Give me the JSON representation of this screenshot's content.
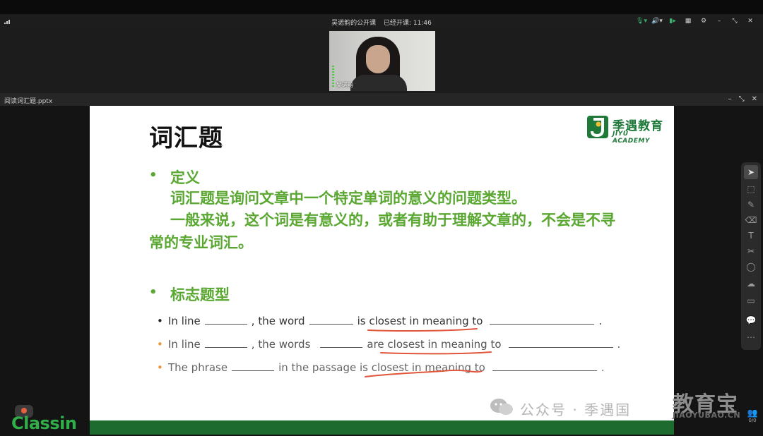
{
  "session": {
    "course_title": "吴诺韵的公开课",
    "elapsed_label": "已经开课: 11:46"
  },
  "video": {
    "participant_name": "吴诺韵"
  },
  "file": {
    "name": "阅读词汇题.pptx"
  },
  "slide": {
    "title": "词汇题",
    "logo_cn": "季遇教育",
    "logo_en": "JIYU ACADEMY",
    "definition_heading": "定义",
    "definition_line1": "词汇题是询问文章中一个特定单词的意义的问题类型。",
    "definition_line2": "一般来说，这个词是有意义的，或者有助于理解文章的，不会是不寻常的专业词汇。",
    "signal_heading": "标志题型",
    "patterns": [
      {
        "a": "In line",
        "b": ", the word",
        "c": "is closest in meaning to",
        "end": "."
      },
      {
        "a": "In line",
        "b": ", the words",
        "c": "are closest in meaning to",
        "end": "."
      },
      {
        "a": "The phrase",
        "b": "in the passage is closest in meaning to",
        "c": "",
        "end": "."
      }
    ]
  },
  "brand": {
    "name": "Classin"
  },
  "watermark": {
    "text": "公众号 · 季遇国",
    "big": "教育宝",
    "url": "JIAOYUBAO.CN"
  },
  "counter": "0/0",
  "colors": {
    "accent_green": "#5aa832",
    "footer_green": "#1e6b2f",
    "ink_red": "#e2553a"
  },
  "toolbar_icons": [
    "cursor-icon",
    "select-icon",
    "pen-icon",
    "eraser-icon",
    "text-icon",
    "scissors-icon",
    "shape-icon",
    "cloud-icon",
    "toolbox-icon",
    "chat-icon",
    "more-icon"
  ]
}
